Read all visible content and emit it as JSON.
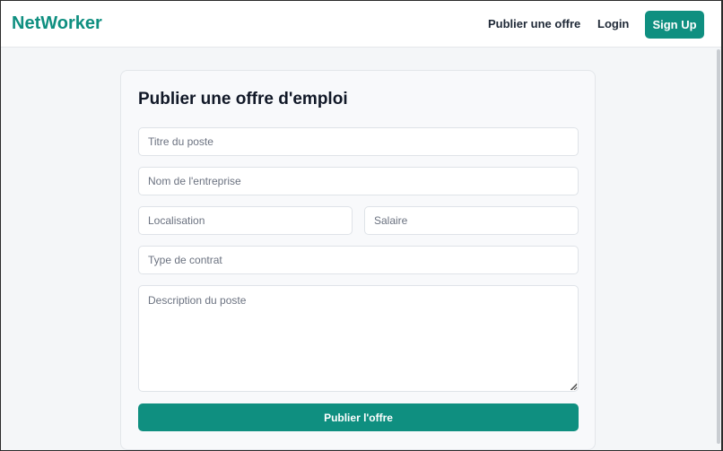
{
  "navbar": {
    "logo": "NetWorker",
    "links": {
      "publish": "Publier une offre",
      "login": "Login",
      "signup": "Sign Up"
    }
  },
  "form": {
    "title": "Publier une offre d'emploi",
    "fields": {
      "job_title": {
        "placeholder": "Titre du poste",
        "value": ""
      },
      "company": {
        "placeholder": "Nom de l'entreprise",
        "value": ""
      },
      "location": {
        "placeholder": "Localisation",
        "value": ""
      },
      "salary": {
        "placeholder": "Salaire",
        "value": ""
      },
      "contract_type": {
        "placeholder": "Type de contrat",
        "value": ""
      },
      "description": {
        "placeholder": "Description du poste",
        "value": ""
      }
    },
    "submit_label": "Publier l'offre"
  },
  "theme": {
    "accent": "#0f8f80",
    "background": "#f4f6f8"
  }
}
